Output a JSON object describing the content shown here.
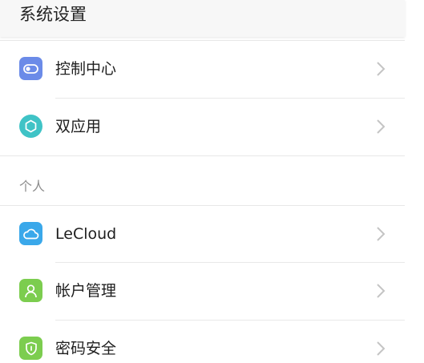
{
  "header": {
    "title": "系统设置"
  },
  "items_top": [
    {
      "label": "控制中心",
      "icon": "toggle-icon",
      "color": "#6b8be8"
    },
    {
      "label": "双应用",
      "icon": "cube-icon",
      "color": "#3fc3c6"
    }
  ],
  "section": {
    "title": "个人"
  },
  "items_personal": [
    {
      "label": "LeCloud",
      "icon": "cloud-icon",
      "color": "#3aa8ea"
    },
    {
      "label": "帐户管理",
      "icon": "person-icon",
      "color": "#7ccd4f"
    },
    {
      "label": "密码安全",
      "icon": "shield-icon",
      "color": "#7ccd4f"
    }
  ],
  "colors": {
    "chevron": "#c4c4c4",
    "divider": "#e8e8e8",
    "section_text": "#8d8d8d"
  }
}
